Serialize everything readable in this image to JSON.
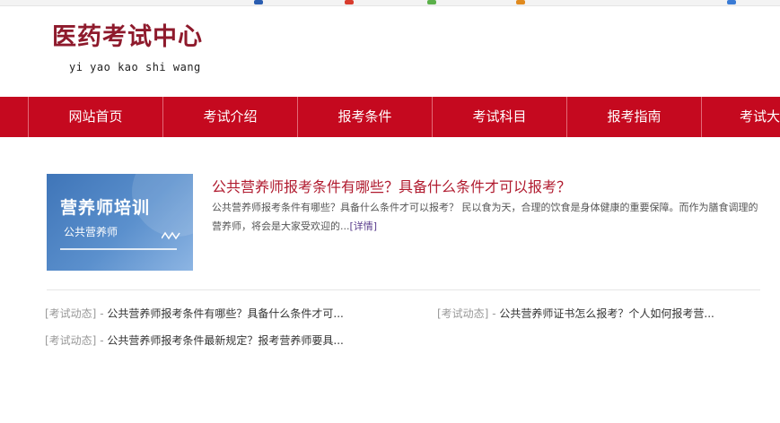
{
  "header": {
    "title": "医药考试中心",
    "subtitle": "yi yao kao shi wang"
  },
  "nav": {
    "items": [
      "网站首页",
      "考试介绍",
      "报考条件",
      "考试科目",
      "报考指南",
      "考试大"
    ]
  },
  "featured": {
    "thumbnail_title": "营养师培训",
    "thumbnail_subtitle": "公共营养师",
    "title": "公共营养师报考条件有哪些？具备什么条件才可以报考？",
    "summary": "公共营养师报考条件有哪些？具备什么条件才可以报考？ 民以食为天，合理的饮食是身体健康的重要保障。而作为膳食调理的营养师，将会是大家受欢迎的...",
    "detail_label": "[详情]"
  },
  "news": [
    {
      "category": "[考试动态]",
      "separator": "-",
      "title": "公共营养师报考条件有哪些？具备什么条件才可..."
    },
    {
      "category": "[考试动态]",
      "separator": "-",
      "title": "公共营养师证书怎么报考？个人如何报考营..."
    },
    {
      "category": "[考试动态]",
      "separator": "-",
      "title": "公共营养师报考条件最新规定？报考营养师要具..."
    }
  ],
  "colors": {
    "brand_red": "#c5091f",
    "title_red": "#8e1a2c",
    "link_red": "#b01a2e",
    "thumb_blue": "#4a82c3"
  }
}
